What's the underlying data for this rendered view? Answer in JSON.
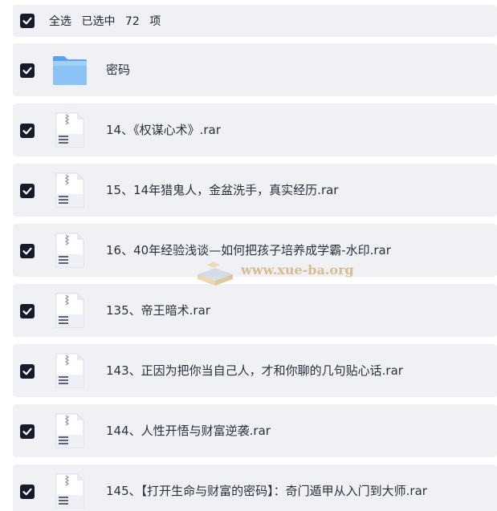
{
  "header": {
    "select_all_label": "全选",
    "selected_prefix": "已选中",
    "selected_count": "72",
    "selected_suffix": "项"
  },
  "items": [
    {
      "name": "密码",
      "icon": "folder-icon",
      "checked": true
    },
    {
      "name": "14、《权谋心术》.rar",
      "icon": "archive-file-icon",
      "checked": true
    },
    {
      "name": "15、14年猎鬼人，金盆洗手，真实经历.rar",
      "icon": "archive-file-icon",
      "checked": true
    },
    {
      "name": "16、40年经验浅谈—如何把孩子培养成学霸-水印.rar",
      "icon": "archive-file-icon",
      "checked": true
    },
    {
      "name": "135、帝王暗术.rar",
      "icon": "archive-file-icon",
      "checked": true
    },
    {
      "name": "143、正因为把你当自己人，才和你聊的几句贴心话.rar",
      "icon": "archive-file-icon",
      "checked": true
    },
    {
      "name": "144、人性开悟与财富逆袭.rar",
      "icon": "archive-file-icon",
      "checked": true
    },
    {
      "name": "145、【打开生命与财富的密码】：奇门遁甲从入门到大师.rar",
      "icon": "archive-file-icon",
      "checked": true
    }
  ],
  "watermark": {
    "text": "www.xue-ba.org"
  },
  "colors": {
    "row_bg": "#eff1f5",
    "checkbox_bg": "#161a2b",
    "folder_blue": "#6aaef0",
    "text": "#2a2f3d"
  }
}
